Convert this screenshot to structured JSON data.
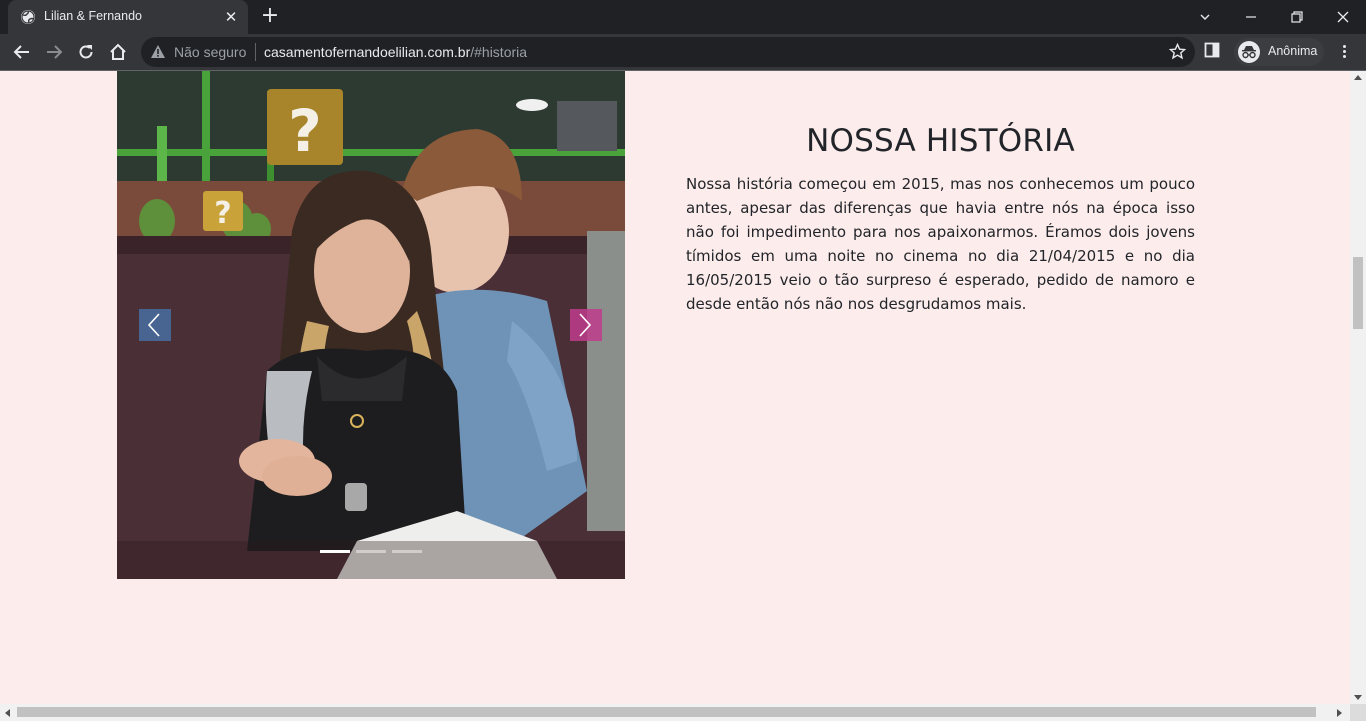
{
  "browser": {
    "tab_title": "Lilian & Fernando",
    "tab_icon": "globe-icon",
    "address": {
      "security_label": "Não seguro",
      "url_host": "casamentofernandoelilian.com.br",
      "url_path": "/#historia"
    },
    "profile_label": "Anônima",
    "colors": {
      "frame": "#202124",
      "toolbar": "#35363a"
    }
  },
  "page": {
    "background": "#fdecec",
    "story": {
      "title": "NOSSA HISTÓRIA",
      "text": "Nossa história começou em 2015, mas nos conhecemos um pouco antes, apesar das diferenças que havia entre nós na época isso não foi impedimento para nos apaixonarmos. Éramos dois jovens tímidos em uma noite no cinema no dia 21/04/2015 e no dia 16/05/2015 veio o tão surpreso é esperado, pedido de namoro e desde então nós não nos desgrudamos mais."
    },
    "carousel": {
      "slide_count": 3,
      "active_slide": 1,
      "prev_color": "#466ea0",
      "next_color": "#be3c8c"
    }
  }
}
